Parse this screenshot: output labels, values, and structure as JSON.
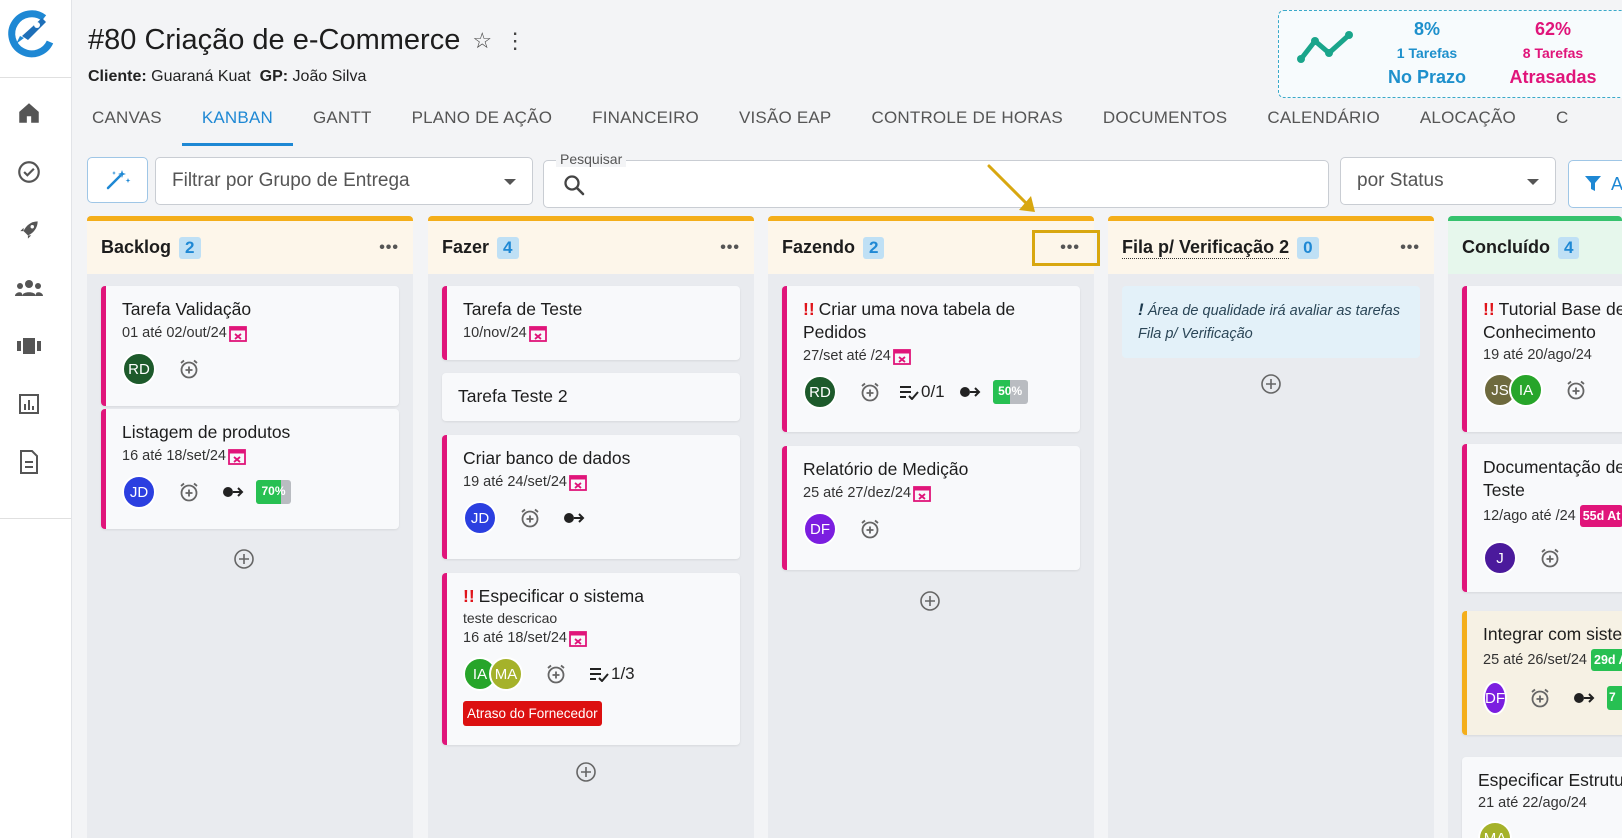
{
  "nav": {
    "logo": "rocket-logo",
    "items": [
      {
        "name": "home-icon"
      },
      {
        "name": "check-circle-icon"
      },
      {
        "name": "rocket-icon"
      },
      {
        "name": "team-icon"
      },
      {
        "name": "carousel-icon"
      },
      {
        "name": "chart-icon"
      },
      {
        "name": "document-icon"
      }
    ]
  },
  "project": {
    "title": "#80 Criação de e-Commerce",
    "client_label": "Cliente:",
    "client": "Guaraná Kuat",
    "gp_label": "GP:",
    "gp": "João Silva"
  },
  "kpi": {
    "on_time": {
      "pct": "8%",
      "count": "1 Tarefas",
      "label": "No Prazo"
    },
    "late": {
      "pct": "62%",
      "count": "8 Tarefas",
      "label": "Atrasadas"
    }
  },
  "tabs": [
    "CANVAS",
    "KANBAN",
    "GANTT",
    "PLANO DE AÇÃO",
    "FINANCEIRO",
    "VISÃO EAP",
    "CONTROLE DE HORAS",
    "DOCUMENTOS",
    "CALENDÁRIO",
    "ALOCAÇÃO",
    "C"
  ],
  "active_tab": "KANBAN",
  "filters": {
    "group_placeholder": "Filtrar por Grupo de Entrega",
    "search_label": "Pesquisar",
    "search_value": "",
    "status_value": "por Status",
    "filter_button": "A"
  },
  "columns": [
    {
      "name": "Backlog",
      "count": "2",
      "cards": [
        {
          "title": "Tarefa Validação",
          "date": "01 até 02/out/24",
          "avatars": [
            {
              "initials": "RD",
              "color": "#1d5a2b"
            }
          ]
        },
        {
          "title": "Listagem de produtos",
          "date": "16 até 18/set/24",
          "avatars": [
            {
              "initials": "JD",
              "color": "#2b3fe0"
            }
          ],
          "progress": "70%"
        }
      ]
    },
    {
      "name": "Fazer",
      "count": "4",
      "cards": [
        {
          "title": "Tarefa de Teste",
          "date": "10/nov/24"
        },
        {
          "title": "Tarefa Teste 2"
        },
        {
          "title": "Criar banco de dados",
          "date": "19 até 24/set/24",
          "avatars": [
            {
              "initials": "JD",
              "color": "#2b3fe0"
            }
          ]
        },
        {
          "title": "Especificar o sistema",
          "description": "teste descricao",
          "date": "16 até 18/set/24",
          "avatars": [
            {
              "initials": "IA",
              "color": "#27a52a"
            },
            {
              "initials": "MA",
              "color": "#a5b22a"
            }
          ],
          "checklist": "1/3",
          "tag": "Atraso do Fornecedor"
        }
      ]
    },
    {
      "name": "Fazendo",
      "count": "2",
      "cards": [
        {
          "title": "Criar uma nova tabela de Pedidos",
          "date": "27/set até /24",
          "avatars": [
            {
              "initials": "RD",
              "color": "#1d5a2b"
            }
          ],
          "checklist": "0/1",
          "progress": "50%"
        },
        {
          "title": "Relatório de Medição",
          "date": "25 até 27/dez/24",
          "avatars": [
            {
              "initials": "DF",
              "color": "#7b1ee0"
            }
          ]
        }
      ]
    },
    {
      "name": "Fila p/ Verificação 2",
      "count": "0",
      "note_mark": "!",
      "note": "Área de qualidade irá avaliar as tarefas Fila p/ Verificação"
    },
    {
      "name": "Concluído",
      "count": "4",
      "cards": [
        {
          "title": "Tutorial Base de Conhecimento",
          "date": "19 até 20/ago/24",
          "avatars": [
            {
              "initials": "JS",
              "color": "#6e6a3e"
            },
            {
              "initials": "IA",
              "color": "#27a52a"
            }
          ]
        },
        {
          "title": "Documentação de Teste",
          "date": "12/ago até /24",
          "badge": "55d At",
          "avatars": [
            {
              "initials": "J",
              "color": "#4b1a9c"
            }
          ]
        },
        {
          "title": "Integrar com siste",
          "date": "25 até 26/set/24",
          "badge": "29d A",
          "avatars": [
            {
              "initials": "DF",
              "color": "#7b1ee0"
            }
          ],
          "progress": "7"
        },
        {
          "title": "Especificar Estrutu",
          "date": "21 até 22/ago/24",
          "avatars": [
            {
              "initials": "MA",
              "color": "#a5b22a"
            }
          ]
        }
      ]
    }
  ],
  "colors": {
    "accent": "#1e88d4",
    "late": "#e0157a",
    "ok": "#27c052",
    "column_top": "#f4ae1a"
  }
}
